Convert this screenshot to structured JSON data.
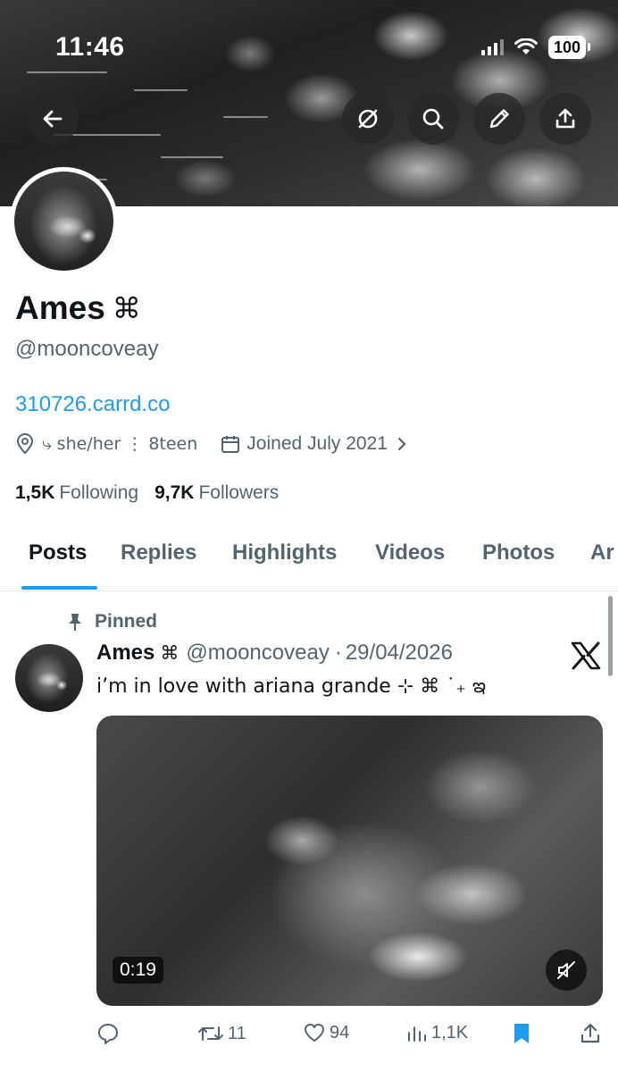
{
  "status_bar": {
    "time": "11:46",
    "battery": "100"
  },
  "profile": {
    "display_name": "Ames",
    "name_emoji": "⌘",
    "handle": "@mooncoveay",
    "link": "310726.carrd.co",
    "location": "⤷ she/her ⋮ 8teen",
    "joined": "Joined July 2021",
    "following_count": "1,5K",
    "following_label": "Following",
    "followers_count": "9,7K",
    "followers_label": "Followers"
  },
  "tabs": [
    "Posts",
    "Replies",
    "Highlights",
    "Videos",
    "Photos",
    "Ar"
  ],
  "post": {
    "pinned_label": "Pinned",
    "author_name": "Ames",
    "author_emoji": "⌘",
    "author_handle": "@mooncoveay",
    "date": "29/04/2026",
    "separator": "·",
    "text": "i’m in love with ariana grande ⊹ ⌘ ˙₊ ఇ",
    "video_duration": "0:19",
    "retweets": "11",
    "likes": "94",
    "views": "1,1K"
  },
  "colors": {
    "accent": "#1d9bf0",
    "secondary_text": "#536471",
    "text": "#0f1419"
  }
}
